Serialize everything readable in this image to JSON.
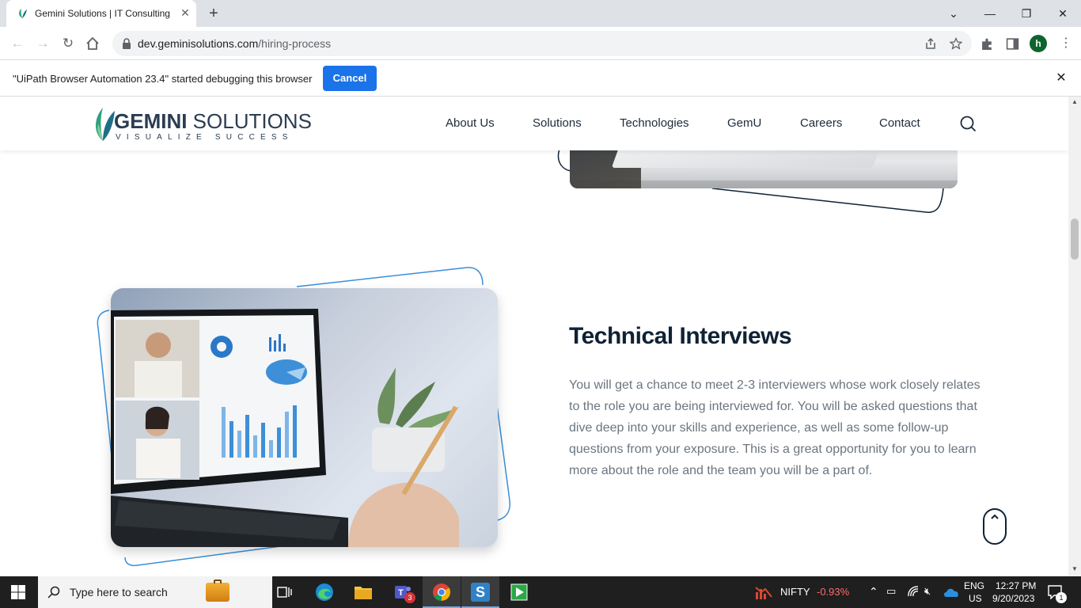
{
  "browser": {
    "tab_title": "Gemini Solutions | IT Consulting",
    "url_domain": "dev.geminisolutions.com",
    "url_path": "/hiring-process",
    "avatar_letter": "h",
    "infobar_text": "\"UiPath Browser Automation 23.4\" started debugging this browser",
    "infobar_cancel": "Cancel"
  },
  "site": {
    "logo_word_bold": "GEMINI",
    "logo_word_rest": " SOLUTIONS",
    "logo_tagline": "VISUALIZE SUCCESS",
    "nav": [
      "About Us",
      "Solutions",
      "Technologies",
      "GemU",
      "Careers",
      "Contact"
    ]
  },
  "content": {
    "heading": "Technical Interviews",
    "paragraph": "You will get a chance to meet 2-3 interviewers whose work closely relates to the role you are being interviewed for. You will be asked questions that dive deep into your skills and experience, as well as some follow-up questions from your exposure. This is a great opportunity for you to learn more about the role and the team you will be a part of."
  },
  "taskbar": {
    "search_placeholder": "Type here to search",
    "teams_badge": "3",
    "nifty_label": "NIFTY",
    "nifty_change": "-0.93%",
    "lang_top": "ENG",
    "lang_bottom": "US",
    "time": "12:27 PM",
    "date": "9/20/2023",
    "notif_count": "1"
  },
  "colors": {
    "accent_blue": "#1a73e8",
    "brand_navy": "#0f2234",
    "frame_blue": "#3a8fd8",
    "nifty_red": "#ff6b6b"
  }
}
